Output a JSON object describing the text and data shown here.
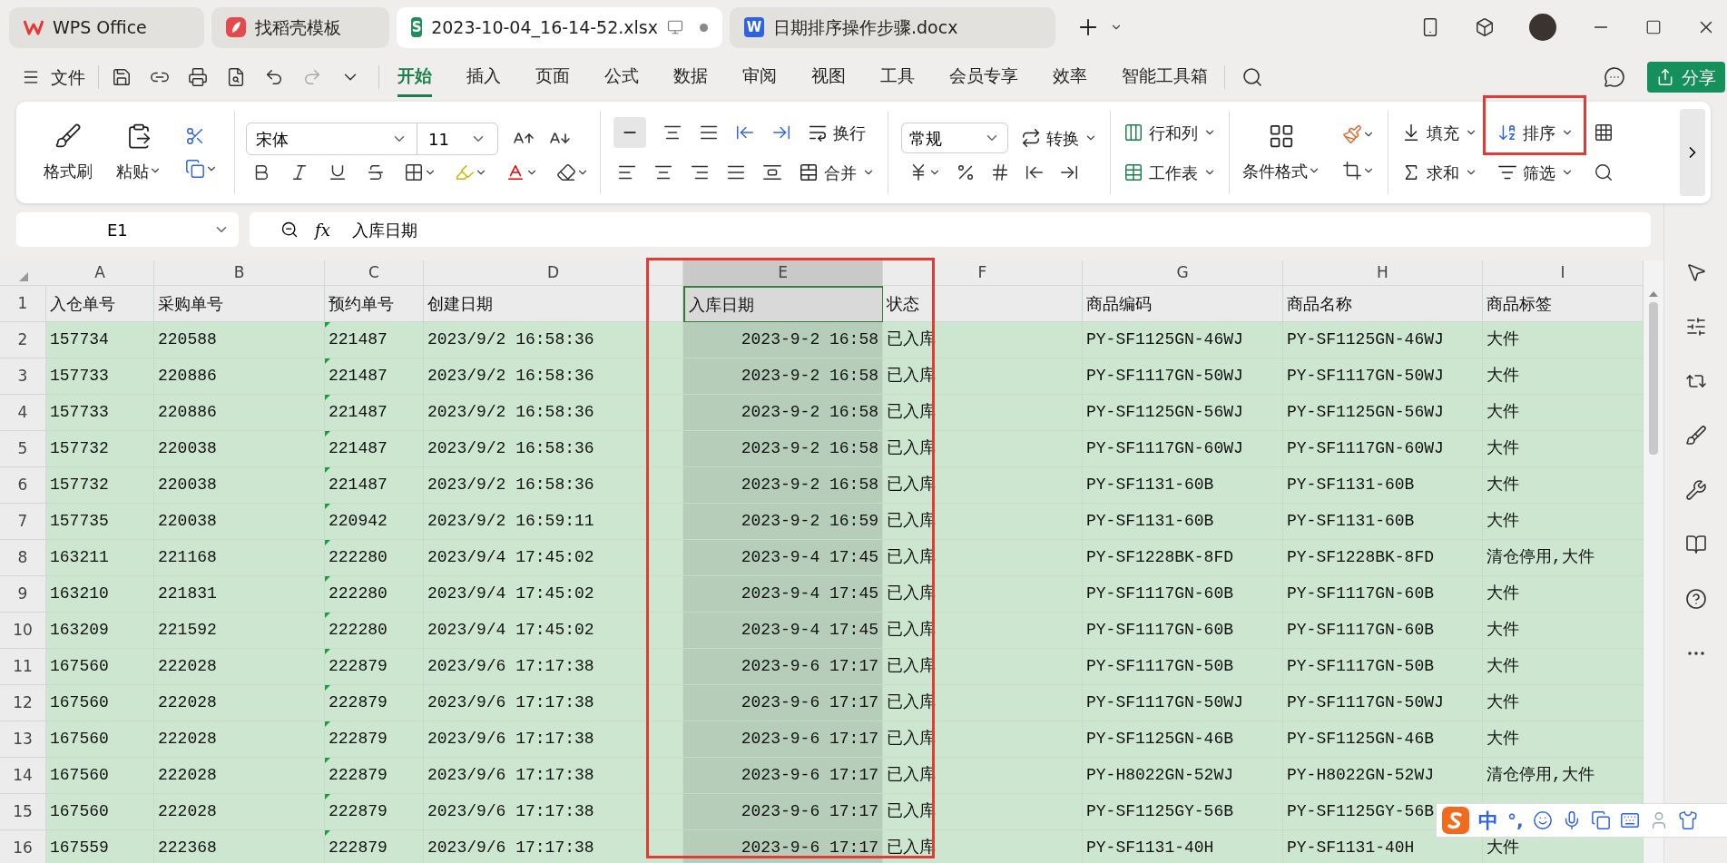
{
  "tabs": [
    {
      "label": "WPS Office",
      "kind": "home",
      "selected": false
    },
    {
      "label": "找稻壳模板",
      "kind": "template",
      "selected": false
    },
    {
      "label": "2023-10-04_16-14-52.xlsx",
      "kind": "sheet",
      "badge": "S",
      "selected": true
    },
    {
      "label": "日期排序操作步骤.docx",
      "kind": "doc",
      "badge": "W",
      "selected": false
    }
  ],
  "menu": {
    "file": "文件",
    "tabs": [
      {
        "label": "开始",
        "selected": true
      },
      {
        "label": "插入",
        "selected": false
      },
      {
        "label": "页面",
        "selected": false
      },
      {
        "label": "公式",
        "selected": false
      },
      {
        "label": "数据",
        "selected": false
      },
      {
        "label": "审阅",
        "selected": false
      },
      {
        "label": "视图",
        "selected": false
      },
      {
        "label": "工具",
        "selected": false
      },
      {
        "label": "会员专享",
        "selected": false
      },
      {
        "label": "效率",
        "selected": false
      },
      {
        "label": "智能工具箱",
        "selected": false
      }
    ],
    "share": "分享"
  },
  "ribbon": {
    "format_painter": "格式刷",
    "paste": "粘贴",
    "font": "宋体",
    "font_size": "11",
    "wrap": "换行",
    "merge": "合并",
    "number_format": "常规",
    "convert": "转换",
    "rows_cols": "行和列",
    "worksheet": "工作表",
    "cond_format": "条件格式",
    "fill": "填充",
    "sort": "排序",
    "sum": "求和",
    "filter": "筛选"
  },
  "formula_bar": {
    "name_box": "E1",
    "fx": "fx",
    "value": "入库日期"
  },
  "grid": {
    "columns": [
      {
        "label": "A",
        "selected": false,
        "text_numbers": false
      },
      {
        "label": "B",
        "selected": false,
        "text_numbers": false
      },
      {
        "label": "C",
        "selected": false,
        "text_numbers": true
      },
      {
        "label": "D",
        "selected": false,
        "text_numbers": false
      },
      {
        "label": "E",
        "selected": true,
        "text_numbers": false
      },
      {
        "label": "F",
        "selected": false,
        "text_numbers": false
      },
      {
        "label": "G",
        "selected": false,
        "text_numbers": false
      },
      {
        "label": "H",
        "selected": false,
        "text_numbers": false
      },
      {
        "label": "I",
        "selected": false,
        "text_numbers": false
      }
    ],
    "rows": [
      {
        "label": "1",
        "kind": "header",
        "active": true,
        "cells": [
          "入仓单号",
          "采购单号",
          "预约单号",
          "创建日期",
          "入库日期",
          "状态",
          "商品编码",
          "商品名称",
          "商品标签"
        ]
      },
      {
        "label": "2",
        "kind": "data",
        "active": false,
        "cells": [
          "157734",
          "220588",
          "221487",
          "2023/9/2 16:58:36",
          "2023-9-2 16:58",
          "已入库",
          "PY-SF1125GN-46WJ",
          "PY-SF1125GN-46WJ",
          "大件"
        ]
      },
      {
        "label": "3",
        "kind": "data",
        "active": false,
        "cells": [
          "157733",
          "220886",
          "221487",
          "2023/9/2 16:58:36",
          "2023-9-2 16:58",
          "已入库",
          "PY-SF1117GN-50WJ",
          "PY-SF1117GN-50WJ",
          "大件"
        ]
      },
      {
        "label": "4",
        "kind": "data",
        "active": false,
        "cells": [
          "157733",
          "220886",
          "221487",
          "2023/9/2 16:58:36",
          "2023-9-2 16:58",
          "已入库",
          "PY-SF1125GN-56WJ",
          "PY-SF1125GN-56WJ",
          "大件"
        ]
      },
      {
        "label": "5",
        "kind": "data",
        "active": false,
        "cells": [
          "157732",
          "220038",
          "221487",
          "2023/9/2 16:58:36",
          "2023-9-2 16:58",
          "已入库",
          "PY-SF1117GN-60WJ",
          "PY-SF1117GN-60WJ",
          "大件"
        ]
      },
      {
        "label": "6",
        "kind": "data",
        "active": false,
        "cells": [
          "157732",
          "220038",
          "221487",
          "2023/9/2 16:58:36",
          "2023-9-2 16:58",
          "已入库",
          "PY-SF1131-60B",
          "PY-SF1131-60B",
          "大件"
        ]
      },
      {
        "label": "7",
        "kind": "data",
        "active": false,
        "cells": [
          "157735",
          "220038",
          "220942",
          "2023/9/2 16:59:11",
          "2023-9-2 16:59",
          "已入库",
          "PY-SF1131-60B",
          "PY-SF1131-60B",
          "大件"
        ]
      },
      {
        "label": "8",
        "kind": "data",
        "active": false,
        "cells": [
          "163211",
          "221168",
          "222280",
          "2023/9/4 17:45:02",
          "2023-9-4 17:45",
          "已入库",
          "PY-SF1228BK-8FD",
          "PY-SF1228BK-8FD",
          "清仓停用,大件"
        ]
      },
      {
        "label": "9",
        "kind": "data",
        "active": false,
        "cells": [
          "163210",
          "221831",
          "222280",
          "2023/9/4 17:45:02",
          "2023-9-4 17:45",
          "已入库",
          "PY-SF1117GN-60B",
          "PY-SF1117GN-60B",
          "大件"
        ]
      },
      {
        "label": "10",
        "kind": "data",
        "active": false,
        "cells": [
          "163209",
          "221592",
          "222280",
          "2023/9/4 17:45:02",
          "2023-9-4 17:45",
          "已入库",
          "PY-SF1117GN-60B",
          "PY-SF1117GN-60B",
          "大件"
        ]
      },
      {
        "label": "11",
        "kind": "data",
        "active": false,
        "cells": [
          "167560",
          "222028",
          "222879",
          "2023/9/6 17:17:38",
          "2023-9-6 17:17",
          "已入库",
          "PY-SF1117GN-50B",
          "PY-SF1117GN-50B",
          "大件"
        ]
      },
      {
        "label": "12",
        "kind": "data",
        "active": false,
        "cells": [
          "167560",
          "222028",
          "222879",
          "2023/9/6 17:17:38",
          "2023-9-6 17:17",
          "已入库",
          "PY-SF1117GN-50WJ",
          "PY-SF1117GN-50WJ",
          "大件"
        ]
      },
      {
        "label": "13",
        "kind": "data",
        "active": false,
        "cells": [
          "167560",
          "222028",
          "222879",
          "2023/9/6 17:17:38",
          "2023-9-6 17:17",
          "已入库",
          "PY-SF1125GN-46B",
          "PY-SF1125GN-46B",
          "大件"
        ]
      },
      {
        "label": "14",
        "kind": "data",
        "active": false,
        "cells": [
          "167560",
          "222028",
          "222879",
          "2023/9/6 17:17:38",
          "2023-9-6 17:17",
          "已入库",
          "PY-H8022GN-52WJ",
          "PY-H8022GN-52WJ",
          "清仓停用,大件"
        ]
      },
      {
        "label": "15",
        "kind": "data",
        "active": false,
        "cells": [
          "167560",
          "222028",
          "222879",
          "2023/9/6 17:17:38",
          "2023-9-6 17:17",
          "已入库",
          "PY-SF1125GY-56B",
          "PY-SF1125GY-56B"
        ]
      },
      {
        "label": "16",
        "kind": "data",
        "active": false,
        "cells": [
          "167559",
          "222368",
          "222879",
          "2023/9/6 17:17:38",
          "2023-9-6 17:17",
          "已入库",
          "PY-SF1131-40H",
          "PY-SF1131-40H",
          "大件"
        ]
      }
    ]
  },
  "ime": {
    "mode": "中",
    "punct": "°,"
  }
}
